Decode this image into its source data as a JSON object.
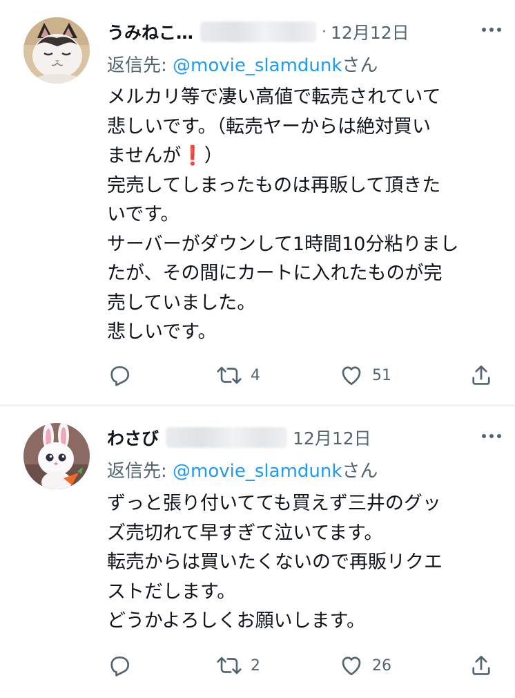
{
  "tweets": [
    {
      "name": "うみねこ…",
      "separator": "·",
      "date": "12月12日",
      "reply_prefix": "返信先: ",
      "reply_handle": "@movie_slamdunk",
      "reply_suffix": "さん",
      "body_lines": [
        "メルカリ等で凄い高値で転売されていて",
        "悲しいです。（転売ヤーからは絶対買い",
        "ませんが",
        "完売してしまったものは再販して頂きた",
        "いです。",
        "サーバーがダウンして1時間10分粘りまし",
        "たが、その間にカートに入れたものが完",
        "売していました。",
        "悲しいです。"
      ],
      "exclamation": "❗",
      "line3_tail": "）",
      "retweets": "4",
      "likes": "51"
    },
    {
      "name": "わさび",
      "date": "12月12日",
      "reply_prefix": "返信先: ",
      "reply_handle": "@movie_slamdunk",
      "reply_suffix": "さん",
      "body_lines": [
        "ずっと張り付いてても買えず三井のグッ",
        "ズ売切れて早すぎて泣いてます。",
        "転売からは買いたくないので再販リクエ",
        "ストだします。",
        "どうかよろしくお願いします。"
      ],
      "retweets": "2",
      "likes": "26"
    }
  ],
  "icons": {
    "more": "more-dots-icon",
    "reply": "reply-bubble-icon",
    "retweet": "retweet-arrows-icon",
    "like": "heart-icon",
    "share": "share-upload-icon"
  },
  "colors": {
    "text": "#0f1419",
    "secondary": "#536471",
    "link": "#1d9bf0",
    "divider": "#eff3f4",
    "exclamation": "#e0245e"
  }
}
